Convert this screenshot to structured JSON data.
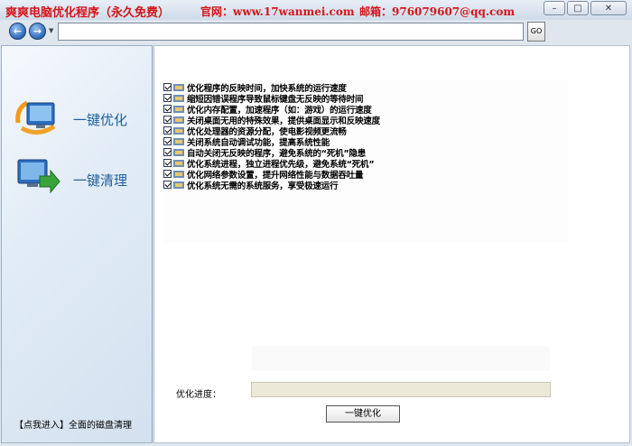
{
  "titlebar": {
    "app_title": "爽爽电脑优化程序（永久免费）",
    "site": "官网：www.17wanmei.com",
    "email": "邮箱：976079607@qq.com",
    "minimize_icon": "minimize-icon",
    "maximize_icon": "maximize-icon",
    "close_icon": "close-icon"
  },
  "navbar": {
    "back_icon": "back-arrow-icon",
    "forward_icon": "forward-arrow-icon",
    "url_value": "",
    "go_label": "GO"
  },
  "sidebar": {
    "items": [
      {
        "label": "一键优化",
        "icon": "monitor-optimize-icon"
      },
      {
        "label": "一键清理",
        "icon": "monitor-clean-icon"
      }
    ],
    "bottom_link": "【点我进入】全面的磁盘清理"
  },
  "options": [
    {
      "label": "优化程序的反映时间，加快系统的运行速度",
      "checked": true
    },
    {
      "label": "缩短因错误程序导致鼠标键盘无反映的等待时间",
      "checked": true
    },
    {
      "label": "优化内存配置，加速程序（如：游戏）的运行速度",
      "checked": true
    },
    {
      "label": "关闭桌面无用的特殊效果，提供桌面显示和反映速度",
      "checked": true
    },
    {
      "label": "优化处理器的资源分配，使电影视频更流畅",
      "checked": true
    },
    {
      "label": "关闭系统自动调试功能，提高系统性能",
      "checked": true
    },
    {
      "label": "自动关闭无反映的程序，避免系统的“死机”隐患",
      "checked": true
    },
    {
      "label": "优化系统进程，独立进程优先级，避免系统“死机”",
      "checked": true
    },
    {
      "label": "优化网络参数设置，提升网络性能与数据吞吐量",
      "checked": true
    },
    {
      "label": "优化系统无需的系统服务，享受极速运行",
      "checked": true
    }
  ],
  "progress": {
    "label": "优化进度：",
    "value": 0
  },
  "action_button": "一键优化"
}
